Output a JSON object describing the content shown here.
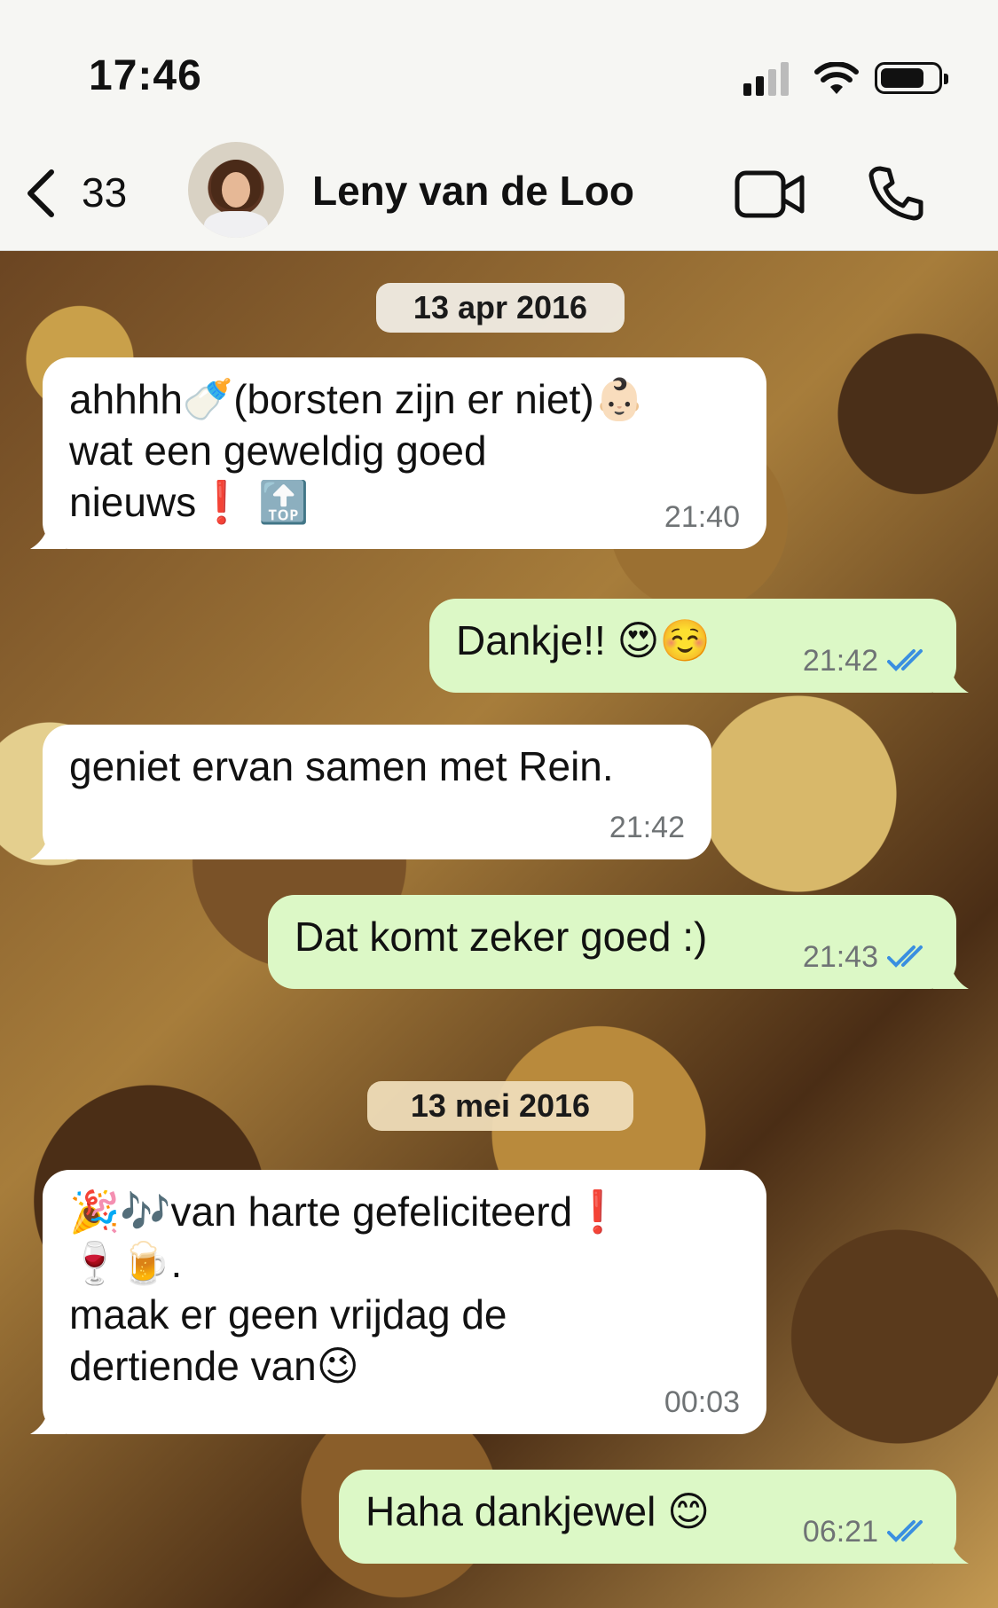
{
  "status": {
    "time": "17:46"
  },
  "header": {
    "back_count": "33",
    "contact_name": "Leny van de Loo"
  },
  "dates": [
    "13 apr 2016",
    "13 mei 2016"
  ],
  "messages": [
    {
      "dir": "in",
      "lines": [
        "ahhhh🍼(borsten zijn er niet)👶🏻",
        "wat een geweldig goed",
        "nieuws❗ 🔝"
      ],
      "time": "21:40"
    },
    {
      "dir": "out",
      "lines": [
        "Dankje!! 😍☺️"
      ],
      "time": "21:42"
    },
    {
      "dir": "in",
      "lines": [
        "geniet ervan samen met Rein."
      ],
      "time": "21:42"
    },
    {
      "dir": "out",
      "lines": [
        "Dat komt zeker goed :)"
      ],
      "time": "21:43"
    },
    {
      "dir": "in",
      "lines": [
        "🎉🎶van harte gefeliciteerd❗",
        "🍷🍺.",
        "maak er geen vrijdag de",
        "dertiende van😉"
      ],
      "time": "00:03"
    },
    {
      "dir": "out",
      "lines": [
        "Haha dankjewel 😊"
      ],
      "time": "06:21"
    }
  ],
  "colors": {
    "incoming": "#ffffff",
    "outgoing": "#dcf8c6",
    "read_ticks": "#3a8fe0"
  }
}
